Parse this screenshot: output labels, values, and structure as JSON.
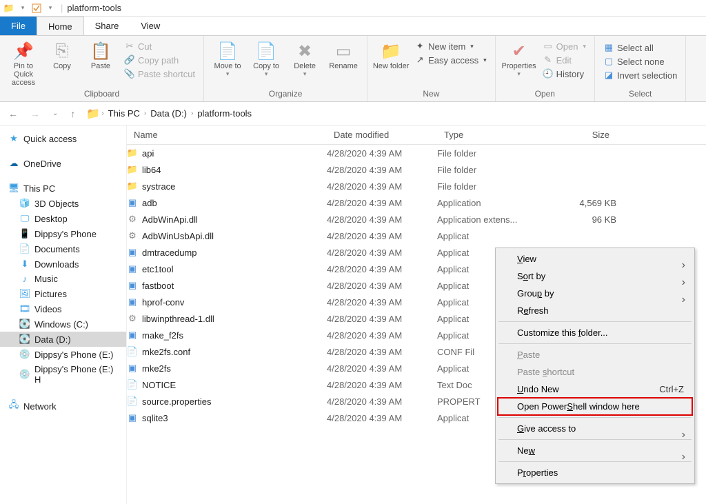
{
  "window": {
    "title": "platform-tools"
  },
  "tabs": {
    "file": "File",
    "home": "Home",
    "share": "Share",
    "view": "View"
  },
  "ribbon": {
    "clipboard": {
      "label": "Clipboard",
      "pin": "Pin to Quick access",
      "copy": "Copy",
      "paste": "Paste",
      "cut": "Cut",
      "copypath": "Copy path",
      "pasteshort": "Paste shortcut"
    },
    "organize": {
      "label": "Organize",
      "moveto": "Move to",
      "copyto": "Copy to",
      "delete": "Delete",
      "rename": "Rename"
    },
    "new": {
      "label": "New",
      "newfolder": "New folder",
      "newitem": "New item",
      "easyaccess": "Easy access"
    },
    "open": {
      "label": "Open",
      "properties": "Properties",
      "open": "Open",
      "edit": "Edit",
      "history": "History"
    },
    "select": {
      "label": "Select",
      "selectall": "Select all",
      "selectnone": "Select none",
      "invert": "Invert selection"
    }
  },
  "breadcrumb": [
    "This PC",
    "Data (D:)",
    "platform-tools"
  ],
  "sidebar": {
    "quickaccess": "Quick access",
    "onedrive": "OneDrive",
    "thispc": "This PC",
    "items": [
      "3D Objects",
      "Desktop",
      "Dippsy's Phone",
      "Documents",
      "Downloads",
      "Music",
      "Pictures",
      "Videos",
      "Windows (C:)",
      "Data (D:)",
      "Dippsy's Phone (E:)",
      "Dippsy's Phone (E:) H"
    ],
    "network": "Network"
  },
  "columns": {
    "name": "Name",
    "date": "Date modified",
    "type": "Type",
    "size": "Size"
  },
  "files": [
    {
      "icon": "folder",
      "name": "api",
      "date": "4/28/2020 4:39 AM",
      "type": "File folder",
      "size": ""
    },
    {
      "icon": "folder",
      "name": "lib64",
      "date": "4/28/2020 4:39 AM",
      "type": "File folder",
      "size": ""
    },
    {
      "icon": "folder",
      "name": "systrace",
      "date": "4/28/2020 4:39 AM",
      "type": "File folder",
      "size": ""
    },
    {
      "icon": "exe",
      "name": "adb",
      "date": "4/28/2020 4:39 AM",
      "type": "Application",
      "size": "4,569 KB"
    },
    {
      "icon": "dll",
      "name": "AdbWinApi.dll",
      "date": "4/28/2020 4:39 AM",
      "type": "Application extens...",
      "size": "96 KB"
    },
    {
      "icon": "dll",
      "name": "AdbWinUsbApi.dll",
      "date": "4/28/2020 4:39 AM",
      "type": "Applicat",
      "size": ""
    },
    {
      "icon": "exe",
      "name": "dmtracedump",
      "date": "4/28/2020 4:39 AM",
      "type": "Applicat",
      "size": ""
    },
    {
      "icon": "exe",
      "name": "etc1tool",
      "date": "4/28/2020 4:39 AM",
      "type": "Applicat",
      "size": ""
    },
    {
      "icon": "exe",
      "name": "fastboot",
      "date": "4/28/2020 4:39 AM",
      "type": "Applicat",
      "size": ""
    },
    {
      "icon": "exe",
      "name": "hprof-conv",
      "date": "4/28/2020 4:39 AM",
      "type": "Applicat",
      "size": ""
    },
    {
      "icon": "dll",
      "name": "libwinpthread-1.dll",
      "date": "4/28/2020 4:39 AM",
      "type": "Applicat",
      "size": ""
    },
    {
      "icon": "exe",
      "name": "make_f2fs",
      "date": "4/28/2020 4:39 AM",
      "type": "Applicat",
      "size": ""
    },
    {
      "icon": "conf",
      "name": "mke2fs.conf",
      "date": "4/28/2020 4:39 AM",
      "type": "CONF Fil",
      "size": ""
    },
    {
      "icon": "exe",
      "name": "mke2fs",
      "date": "4/28/2020 4:39 AM",
      "type": "Applicat",
      "size": ""
    },
    {
      "icon": "txt",
      "name": "NOTICE",
      "date": "4/28/2020 4:39 AM",
      "type": "Text Doc",
      "size": ""
    },
    {
      "icon": "prop",
      "name": "source.properties",
      "date": "4/28/2020 4:39 AM",
      "type": "PROPERT",
      "size": ""
    },
    {
      "icon": "exe",
      "name": "sqlite3",
      "date": "4/28/2020 4:39 AM",
      "type": "Applicat",
      "size": ""
    }
  ],
  "contextmenu": {
    "view": "View",
    "sortby": "Sort by",
    "groupby": "Group by",
    "refresh": "Refresh",
    "customize": "Customize this folder...",
    "paste": "Paste",
    "pasteshort": "Paste shortcut",
    "undo": "Undo New",
    "undo_shortcut": "Ctrl+Z",
    "powershell": "Open PowerShell window here",
    "giveaccess": "Give access to",
    "new": "New",
    "properties": "Properties"
  }
}
